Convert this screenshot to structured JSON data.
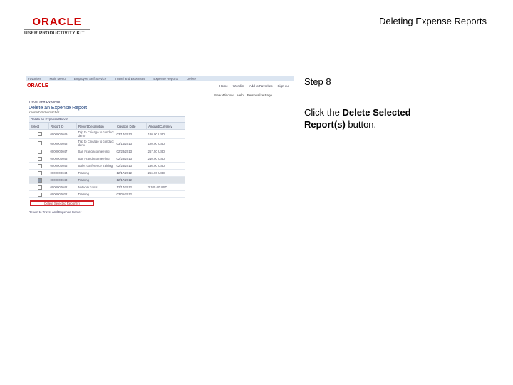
{
  "header": {
    "logo_brand": "ORACLE",
    "logo_product": "USER PRODUCTIVITY KIT",
    "document_title": "Deleting Expense Reports"
  },
  "screenshot": {
    "topbar": [
      "Favorites",
      "Main Menu",
      "Employee Self-Service",
      "Travel and Expenses",
      "Expense Reports",
      "Delete"
    ],
    "brand": "ORACLE",
    "top_links": [
      "Home",
      "Worklist",
      "Add to Favorites",
      "Sign out"
    ],
    "search_links": [
      "New Window",
      "Help",
      "Personalize Page"
    ],
    "breadcrumb": "Travel and Expense",
    "page_title": "Delete an Expense Report",
    "employee_line": "Kenneth Schumacher",
    "section_title": "Delete an Expense Report",
    "columns": [
      "Select",
      "Report ID",
      "Report Description",
      "Creation Date",
      "Amount/Currency"
    ],
    "rows": [
      {
        "id": "0000000049",
        "desc": "Trip to Chicago to conduct demo",
        "date": "03/14/2013",
        "amount": "120.00 USD",
        "selected": false
      },
      {
        "id": "0000000048",
        "desc": "Trip to Chicago to conduct demo",
        "date": "03/14/2013",
        "amount": "120.00 USD",
        "selected": false
      },
      {
        "id": "0000000047",
        "desc": "San Francisco meeting",
        "date": "02/28/2013",
        "amount": "257.50 USD",
        "selected": false
      },
      {
        "id": "0000000046",
        "desc": "San Francisco meeting",
        "date": "02/28/2013",
        "amount": "210.00 USD",
        "selected": false
      },
      {
        "id": "0000000045",
        "desc": "Sales conference training",
        "date": "02/26/2013",
        "amount": "136.00 USD",
        "selected": false
      },
      {
        "id": "0000000044",
        "desc": "Training",
        "date": "12/17/2012",
        "amount": "256.00 USD",
        "selected": false
      },
      {
        "id": "0000000043",
        "desc": "Training",
        "date": "12/17/2012",
        "amount": "",
        "selected": true
      },
      {
        "id": "0000000042",
        "desc": "Network costs",
        "date": "12/17/2012",
        "amount": "3,145.00 USD",
        "selected": false
      },
      {
        "id": "0000000022",
        "desc": "Training",
        "date": "03/05/2012",
        "amount": "",
        "selected": false
      }
    ],
    "delete_button": "Delete Selected Report(s)",
    "return_link": "Return to Travel and Expense Center"
  },
  "instructions": {
    "step_label": "Step 8",
    "text_before": "Click the ",
    "bold_text": "Delete Selected Report(s)",
    "text_after": " button."
  }
}
